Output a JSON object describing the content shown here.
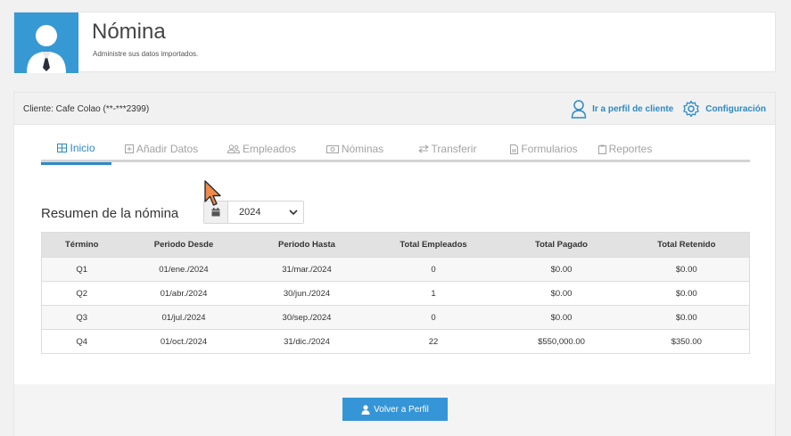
{
  "header": {
    "title": "Nómina",
    "subtitle": "Administre sus datos importados.",
    "avatar_icon": "user-tie-icon"
  },
  "client_bar": {
    "label": "Cliente: Cafe Colao (**-***2399)",
    "actions": [
      {
        "label": "Ir a perfil de cliente",
        "icon": "user-outline-icon"
      },
      {
        "label": "Configuración",
        "icon": "gear-icon"
      }
    ]
  },
  "tabs": [
    {
      "label": "Inicio",
      "icon": "table-icon",
      "active": true
    },
    {
      "label": "Añadir Datos",
      "icon": "plus-square-icon",
      "active": false
    },
    {
      "label": "Empleados",
      "icon": "users-icon",
      "active": false
    },
    {
      "label": "Nóminas",
      "icon": "money-icon",
      "active": false
    },
    {
      "label": "Transferir",
      "icon": "exchange-icon",
      "active": false
    },
    {
      "label": "Formularios",
      "icon": "file-icon",
      "active": false
    },
    {
      "label": "Reportes",
      "icon": "clipboard-icon",
      "active": false
    }
  ],
  "summary": {
    "title": "Resumen de la nómina",
    "year_selected": "2024"
  },
  "table": {
    "columns": [
      "Término",
      "Periodo Desde",
      "Periodo Hasta",
      "Total Empleados",
      "Total Pagado",
      "Total Retenido"
    ],
    "rows": [
      [
        "Q1",
        "01/ene./2024",
        "31/mar./2024",
        "0",
        "$0.00",
        "$0.00"
      ],
      [
        "Q2",
        "01/abr./2024",
        "30/jun./2024",
        "1",
        "$0.00",
        "$0.00"
      ],
      [
        "Q3",
        "01/jul./2024",
        "30/sep./2024",
        "0",
        "$0.00",
        "$0.00"
      ],
      [
        "Q4",
        "01/oct./2024",
        "31/dic./2024",
        "22",
        "$550,000.00",
        "$350.00"
      ]
    ]
  },
  "footer": {
    "back_button": "Volver a Perfil"
  },
  "colors": {
    "accent": "#2c8ac6",
    "avatar_bg": "#3699d4",
    "button_bg": "#3595d6"
  }
}
